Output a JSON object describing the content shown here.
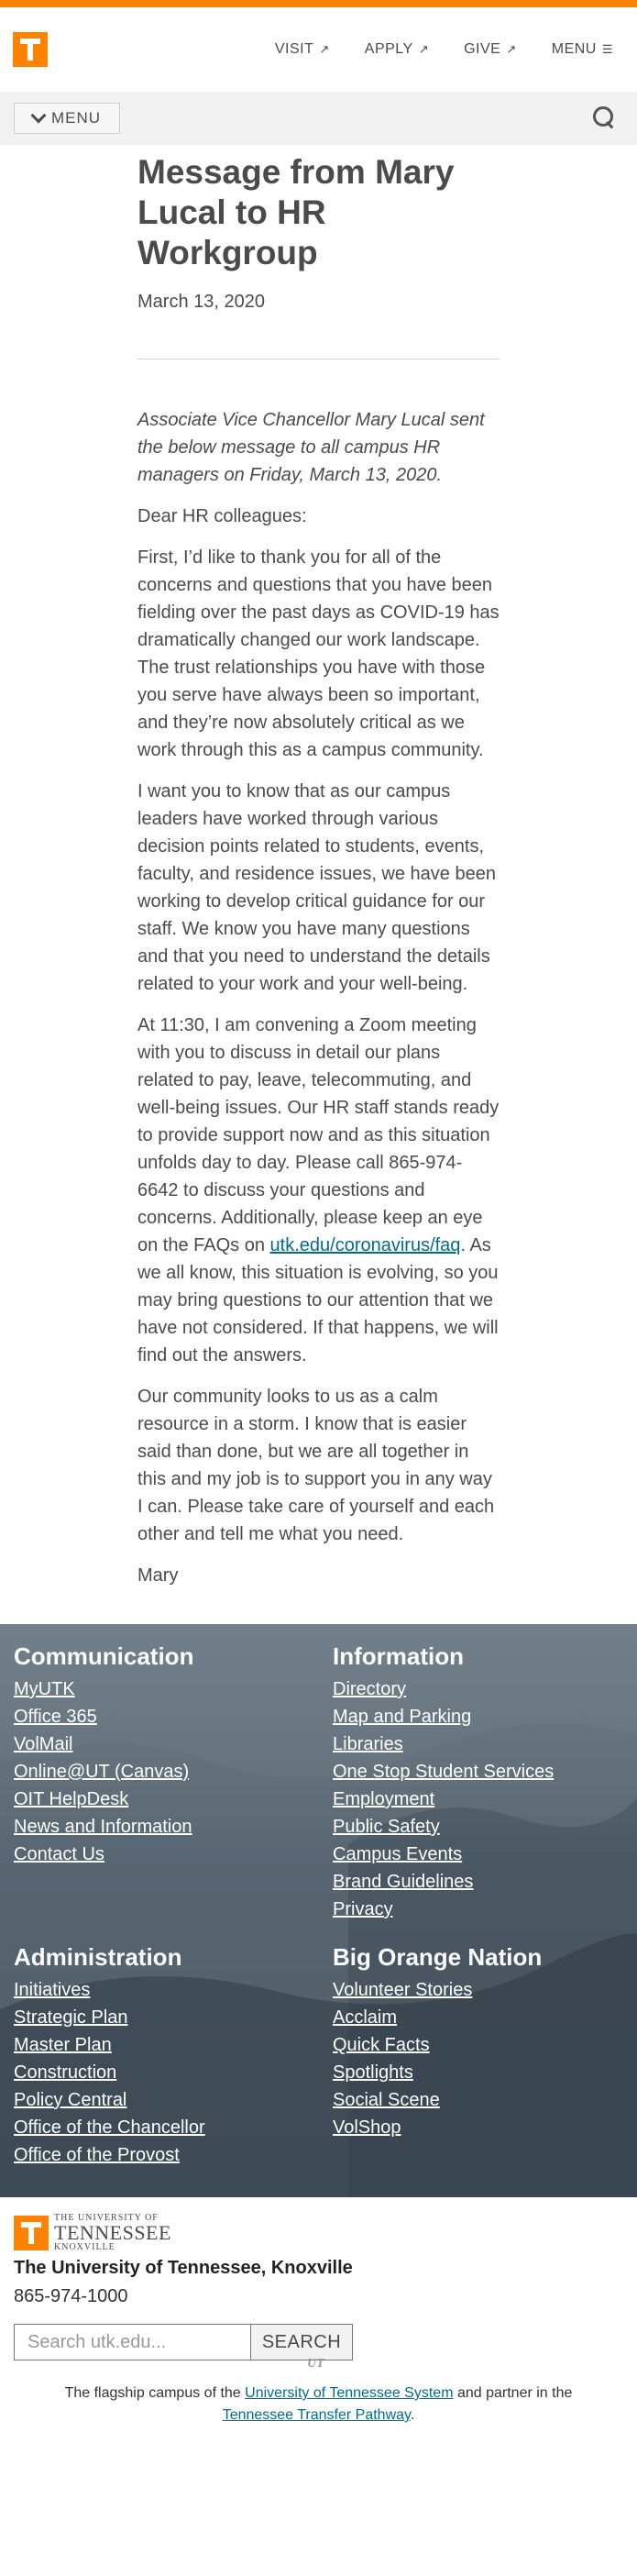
{
  "header": {
    "nav": [
      {
        "label": "VISIT",
        "icon": "external-arrow-icon"
      },
      {
        "label": "APPLY",
        "icon": "external-arrow-icon"
      },
      {
        "label": "GIVE",
        "icon": "external-arrow-icon"
      },
      {
        "label": "MENU",
        "icon": "menu-lines-icon"
      }
    ],
    "arrow_glyph": "↗",
    "menu_glyph": "☰"
  },
  "subnav": {
    "menu_label": "MENU"
  },
  "article": {
    "title": "Message from Mary Lucal to HR Workgroup",
    "date": "March 13, 2020",
    "intro": "Associate Vice Chancellor Mary Lucal sent the below message to all campus HR managers on Friday, March 13, 2020.",
    "salutation": "Dear HR colleagues:",
    "p1": "First, I’d like to thank you for all of the concerns and questions that you have been fielding over the past days as COVID-19 has dramatically changed our work landscape. The trust relationships you have with those you serve have always been so important, and they’re now absolutely critical as we work through this as a campus community.",
    "p2": "I want you to know that as our campus leaders have worked through various decision points related to students, events, faculty, and residence issues, we have been working to develop critical guidance for our staff. We know you have many questions and that you need to understand the details related to your work and your well-being.",
    "p3_before": "At 11:30, I am convening a Zoom meeting with you to discuss in detail our plans related to pay, leave, telecommuting, and well-being issues. Our HR staff stands ready to provide support now and as this situation unfolds day to day. Please call 865-974-6642 to discuss your questions and concerns. Additionally, please keep an eye on the FAQs on ",
    "p3_link": "utk.edu/coronavirus/faq",
    "p3_after": ". As we all know, this situation is evolving, so you may bring questions to our attention that we have not considered. If that happens, we will find out the answers.",
    "p4": "Our community looks to us as a calm resource in a storm. I know that is easier said than done, but we are all together in this and my job is to support you in any way I can. Please take care of yourself and each other and tell me what you need.",
    "signoff": "Mary"
  },
  "footer": {
    "communication": {
      "heading": "Communication",
      "links": [
        "MyUTK",
        "Office 365",
        "VolMail",
        "Online@UT (Canvas)",
        "OIT HelpDesk",
        "News and Information",
        "Contact Us"
      ]
    },
    "information": {
      "heading": "Information",
      "links": [
        "Directory",
        "Map and Parking",
        "Libraries",
        "One Stop Student Services",
        "Employment",
        "Public Safety",
        "Campus Events",
        "Brand Guidelines",
        "Privacy"
      ]
    },
    "administration": {
      "heading": "Administration",
      "links": [
        "Initiatives",
        "Strategic Plan",
        "Master Plan",
        "Construction",
        "Policy Central",
        "Office of the Chancellor",
        "Office of the Provost"
      ]
    },
    "big_orange_nation": {
      "heading": "Big Orange Nation",
      "links": [
        "Volunteer Stories",
        "Acclaim",
        "Quick Facts",
        "Spotlights",
        "Social Scene",
        "VolShop"
      ]
    }
  },
  "bottom": {
    "wordmark_top": "THE UNIVERSITY OF",
    "wordmark_main": "TENNESSEE",
    "wordmark_sub": "KNOXVILLE",
    "university_name": "The University of Tennessee, Knoxville",
    "phone": "865-974-1000",
    "search_placeholder": "Search utk.edu...",
    "search_button": "SEARCH",
    "ut_mark": "UT",
    "tagline_before": "The flagship campus of the ",
    "tagline_link1": "University of Tennessee System",
    "tagline_middle": " and partner in the ",
    "tagline_link2": "Tennessee Transfer Pathway",
    "tagline_end": "."
  },
  "colors": {
    "brand_orange": "#ff8200",
    "link_blue": "#006c93",
    "text_gray": "#4b4b4b",
    "footer_slate": "#5c6b77"
  }
}
